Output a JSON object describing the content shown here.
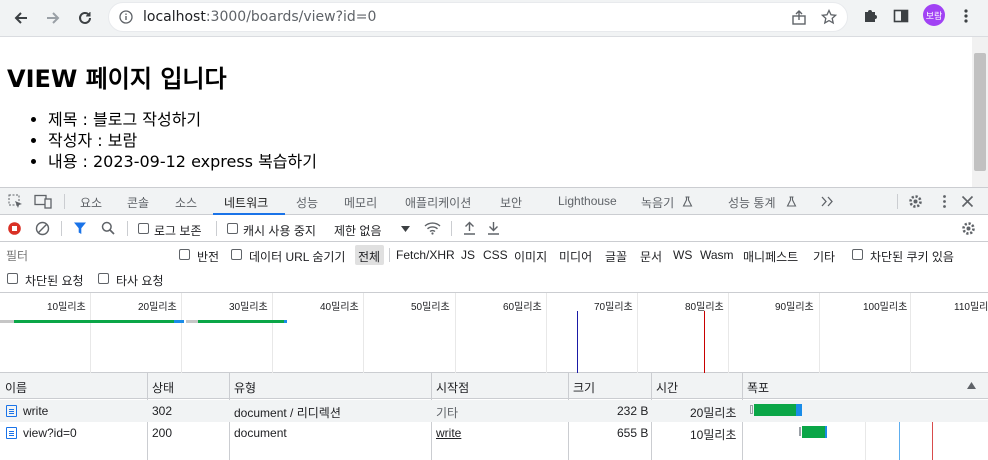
{
  "browser": {
    "url_host": "localhost",
    "url_path": ":3000/boards/view?id=0",
    "profile_label": "보람"
  },
  "page": {
    "heading": "VIEW 페이지 입니다",
    "items": [
      "제목 : 블로그 작성하기",
      "작성자 : 보람",
      "내용 : 2023-09-12 express 복습하기"
    ]
  },
  "devtools": {
    "tabs": [
      "요소",
      "콘솔",
      "소스",
      "네트워크",
      "성능",
      "메모리",
      "애플리케이션",
      "보안",
      "Lighthouse",
      "녹음기",
      "성능 통계"
    ],
    "active_tab": "네트워크",
    "toolbar": {
      "preserve_log": "로그 보존",
      "disable_cache": "캐시 사용 중지",
      "throttling": "제한 없음"
    },
    "filter": {
      "placeholder": "필터",
      "invert": "반전",
      "hide_data_urls": "데이터 URL 숨기기",
      "types": [
        "전체",
        "Fetch/XHR",
        "JS",
        "CSS",
        "이미지",
        "미디어",
        "글꼴",
        "문서",
        "WS",
        "Wasm",
        "매니페스트",
        "기타"
      ],
      "blocked_cookies": "차단된 쿠키 있음",
      "blocked_requests": "차단된 요청",
      "third_party": "타사 요청"
    },
    "timeline_labels": [
      "10밀리초",
      "20밀리초",
      "30밀리초",
      "40밀리초",
      "50밀리초",
      "60밀리초",
      "70밀리초",
      "80밀리초",
      "90밀리초",
      "100밀리초",
      "110밀리초"
    ],
    "columns": [
      "이름",
      "상태",
      "유형",
      "시작점",
      "크기",
      "시간",
      "폭포"
    ],
    "rows": [
      {
        "name": "write",
        "status": "302",
        "type": "document / 리디렉션",
        "initiator": "기타",
        "size": "232 B",
        "time": "20밀리초"
      },
      {
        "name": "view?id=0",
        "status": "200",
        "type": "document",
        "initiator": "write",
        "size": "655 B",
        "time": "10밀리초"
      }
    ]
  },
  "colors": {
    "accent": "#1a73e8",
    "record_red": "#d93025",
    "waterfall_green": "#0aa647",
    "waterfall_blue": "#1a8ce8",
    "dom_content_loaded": "#1a1aa6",
    "load_event": "#c80000"
  }
}
